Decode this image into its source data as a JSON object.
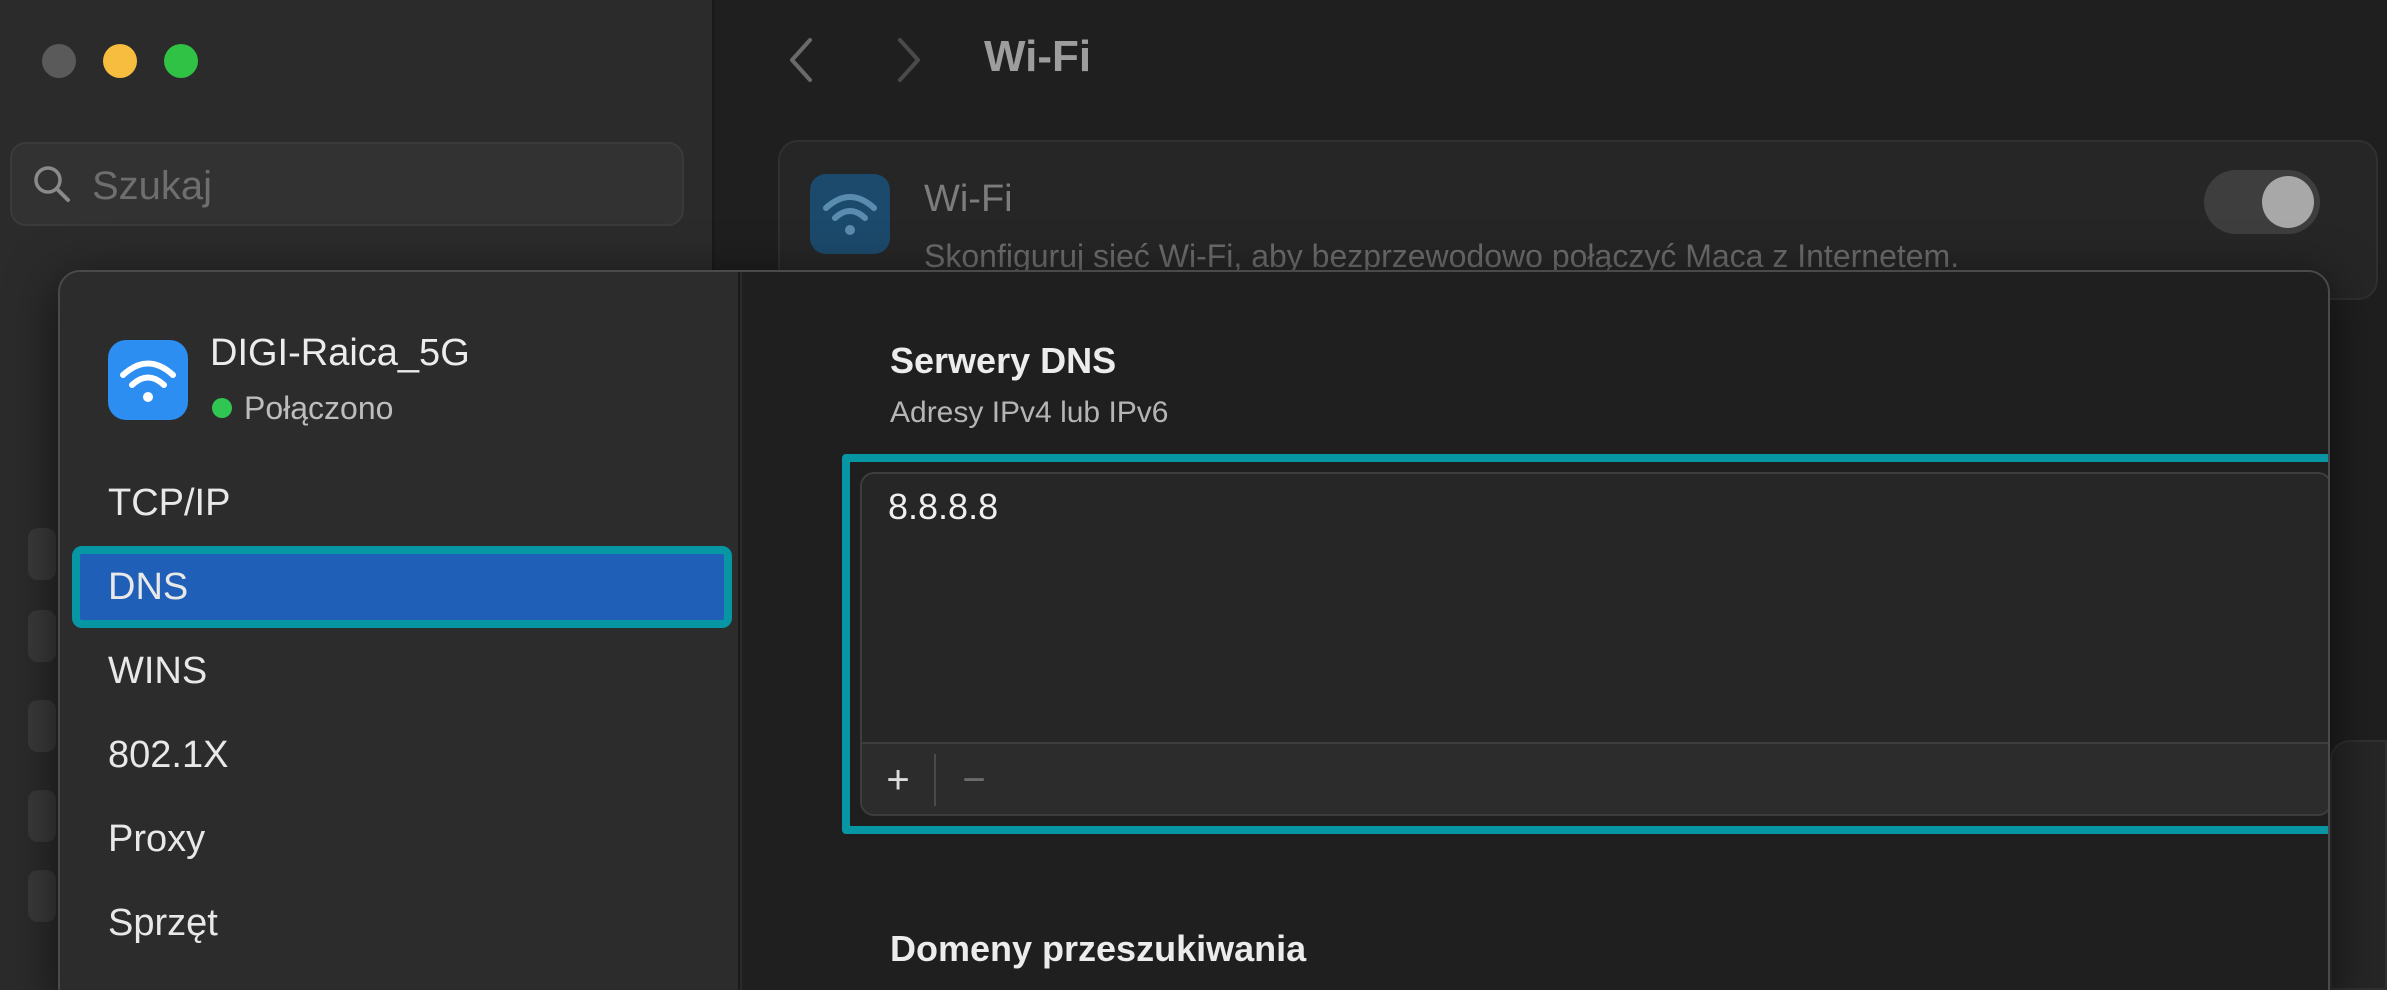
{
  "window": {
    "title": "Wi-Fi",
    "search": {
      "placeholder": "Szukaj"
    }
  },
  "wifi_card": {
    "title": "Wi-Fi",
    "description": "Skonfiguruj sieć Wi-Fi, aby bezprzewodowo połączyć Maca z Internetem.",
    "toggle_on": true
  },
  "dialog": {
    "network": {
      "name": "DIGI-Raica_5G",
      "status": "Połączono",
      "icon": "wifi-icon",
      "status_color": "#30c651"
    },
    "sidebar": {
      "items": [
        {
          "label": "TCP/IP",
          "selected": false
        },
        {
          "label": "DNS",
          "selected": true
        },
        {
          "label": "WINS",
          "selected": false
        },
        {
          "label": "802.1X",
          "selected": false
        },
        {
          "label": "Proxy",
          "selected": false
        },
        {
          "label": "Sprzęt",
          "selected": false
        }
      ]
    },
    "dns": {
      "title": "Serwery DNS",
      "subtitle": "Adresy IPv4 lub IPv6",
      "servers": [
        "8.8.8.8"
      ],
      "add_label": "+",
      "remove_label": "−"
    },
    "search_domains": {
      "title": "Domeny przeszukiwania"
    }
  },
  "colors": {
    "selection": "#1f5fb8",
    "highlight_outline": "#0796a4",
    "wifi_icon_bg": "#2b8ef0"
  }
}
